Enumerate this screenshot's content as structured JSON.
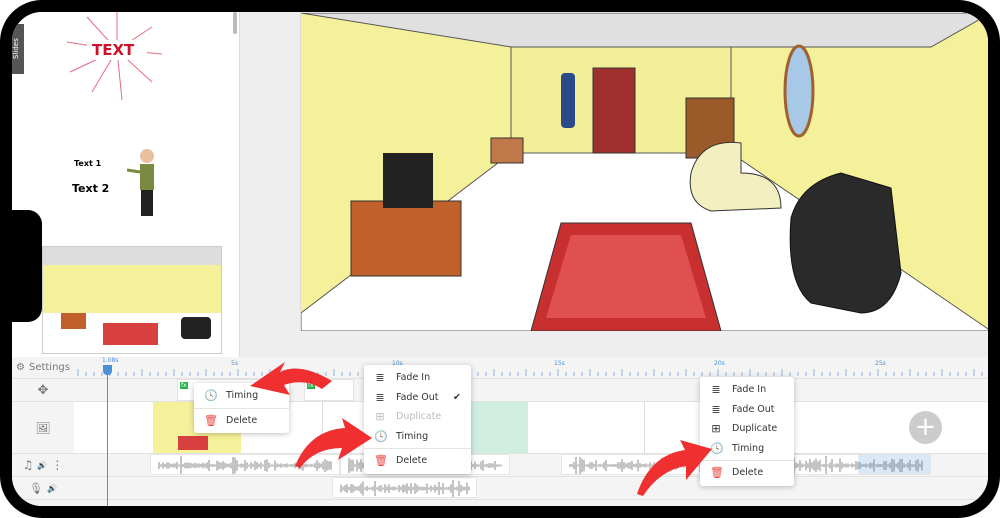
{
  "left_panel": {
    "tab_label": "Slides",
    "slide1_text": "TEXT",
    "slide2_text1": "Text 1",
    "slide2_text2": "Text 2"
  },
  "timeline": {
    "settings_label": "Settings",
    "playhead_time": "1.08s",
    "ruler_ticks": [
      "5s",
      "10s",
      "15s",
      "20s",
      "25s"
    ],
    "row_icons": [
      "move-icon",
      "image-icon",
      "music-icon",
      "mic-icon"
    ],
    "fx_badge": "fx"
  },
  "menus": [
    {
      "items": [
        {
          "label": "Timing",
          "icon": "clock-icon"
        },
        {
          "label": "Delete",
          "icon": "trash-icon"
        }
      ]
    },
    {
      "items": [
        {
          "label": "Fade In",
          "icon": "fade-in-icon"
        },
        {
          "label": "Fade Out",
          "icon": "fade-out-icon",
          "checked": true
        },
        {
          "label": "Duplicate",
          "icon": "duplicate-icon",
          "disabled": true
        },
        {
          "label": "Timing",
          "icon": "clock-icon"
        },
        {
          "label": "Delete",
          "icon": "trash-icon"
        }
      ]
    },
    {
      "items": [
        {
          "label": "Fade In",
          "icon": "fade-in-icon"
        },
        {
          "label": "Fade Out",
          "icon": "fade-out-icon"
        },
        {
          "label": "Duplicate",
          "icon": "duplicate-icon"
        },
        {
          "label": "Timing",
          "icon": "clock-icon"
        },
        {
          "label": "Delete",
          "icon": "trash-icon"
        }
      ]
    }
  ],
  "colors": {
    "accent": "#4a90d9",
    "arrow": "#f03030",
    "delete": "#e44444",
    "wall": "#f5f19a",
    "rug": "#d84040"
  }
}
